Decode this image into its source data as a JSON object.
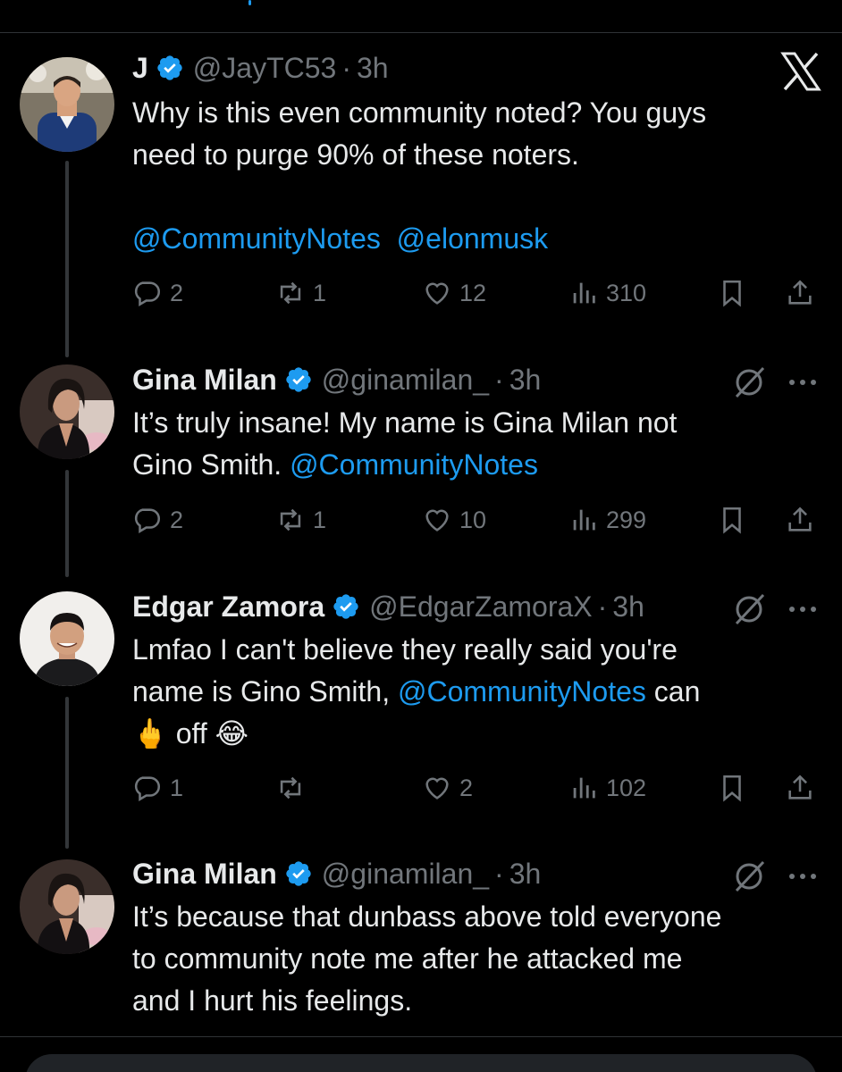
{
  "colors": {
    "accent": "#1d9bf0",
    "muted": "#71767b",
    "text": "#e7e9ea",
    "background": "#000000"
  },
  "header_logo": "X",
  "tweets": [
    {
      "name": "J",
      "handle": "@JayTC53",
      "time": "3h",
      "body_lines": [
        [
          {
            "t": "Why is this even community noted? You guys"
          }
        ],
        [
          {
            "t": "need to purge 90% of these noters."
          }
        ],
        [
          {
            "t": ""
          }
        ],
        [
          {
            "t": "@CommunityNotes",
            "m": true
          },
          {
            "t": "  "
          },
          {
            "t": "@elonmusk",
            "m": true
          }
        ]
      ],
      "replies": "2",
      "reposts": "1",
      "likes": "12",
      "views": "310"
    },
    {
      "name": "Gina Milan",
      "handle": "@ginamilan_",
      "time": "3h",
      "body_lines": [
        [
          {
            "t": "It’s truly insane! My name is Gina Milan not"
          }
        ],
        [
          {
            "t": "Gino Smith. "
          },
          {
            "t": "@CommunityNotes",
            "m": true
          }
        ]
      ],
      "replies": "2",
      "reposts": "1",
      "likes": "10",
      "views": "299"
    },
    {
      "name": "Edgar Zamora",
      "handle": "@EdgarZamoraX",
      "time": "3h",
      "body_lines": [
        [
          {
            "t": "Lmfao I can't believe they really said you're"
          }
        ],
        [
          {
            "t": "name is Gino Smith, "
          },
          {
            "t": "@CommunityNotes",
            "m": true
          },
          {
            "t": " can"
          }
        ],
        [
          {
            "t": "🖕 off 😂"
          }
        ]
      ],
      "replies": "1",
      "reposts": "",
      "likes": "2",
      "views": "102"
    },
    {
      "name": "Gina Milan",
      "handle": "@ginamilan_",
      "time": "3h",
      "body_lines": [
        [
          {
            "t": "It’s because that dunbass above told everyone"
          }
        ],
        [
          {
            "t": "to community note me after he attacked me"
          }
        ],
        [
          {
            "t": "and I hurt his feelings."
          }
        ]
      ]
    }
  ],
  "icons": [
    "verified-icon",
    "x-logo-icon",
    "grok-icon",
    "more-icon",
    "reply-icon",
    "repost-icon",
    "like-icon",
    "views-icon",
    "bookmark-icon",
    "share-icon"
  ]
}
